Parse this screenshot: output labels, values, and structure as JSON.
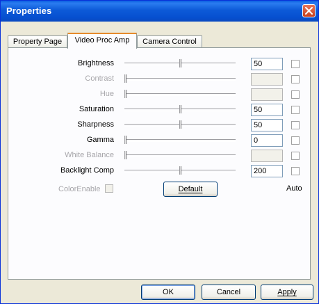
{
  "window": {
    "title": "Properties"
  },
  "tabs": [
    {
      "label": "Property Page"
    },
    {
      "label": "Video Proc Amp"
    },
    {
      "label": "Camera Control"
    }
  ],
  "active_tab": "Video Proc Amp",
  "rows": [
    {
      "label": "Brightness",
      "enabled": true,
      "value": "50",
      "slider_fraction": 0.5,
      "auto_checked": false
    },
    {
      "label": "Contrast",
      "enabled": false,
      "value": "",
      "slider_fraction": 0.0,
      "auto_checked": false
    },
    {
      "label": "Hue",
      "enabled": false,
      "value": "",
      "slider_fraction": 0.0,
      "auto_checked": false
    },
    {
      "label": "Saturation",
      "enabled": true,
      "value": "50",
      "slider_fraction": 0.5,
      "auto_checked": false
    },
    {
      "label": "Sharpness",
      "enabled": true,
      "value": "50",
      "slider_fraction": 0.5,
      "auto_checked": false
    },
    {
      "label": "Gamma",
      "enabled": true,
      "value": "0",
      "slider_fraction": 0.0,
      "auto_checked": false
    },
    {
      "label": "White Balance",
      "enabled": false,
      "value": "",
      "slider_fraction": 0.0,
      "auto_checked": false
    },
    {
      "label": "Backlight Comp",
      "enabled": true,
      "value": "200",
      "slider_fraction": 0.5,
      "auto_checked": false
    }
  ],
  "color_enable": {
    "label": "ColorEnable",
    "enabled": false,
    "checked": false
  },
  "default_button": {
    "label": "Default"
  },
  "auto_column_label": "Auto",
  "footer": {
    "ok_label": "OK",
    "cancel_label": "Cancel",
    "apply_label": "Apply"
  },
  "colors": {
    "titlebar": "#0a5fe0",
    "close_button": "#c8401c",
    "dialog_background": "#ece9d8",
    "active_tab_accent": "#e68b2c",
    "disabled_text": "#a7a6aa"
  },
  "icons": {
    "close": "close-icon"
  }
}
